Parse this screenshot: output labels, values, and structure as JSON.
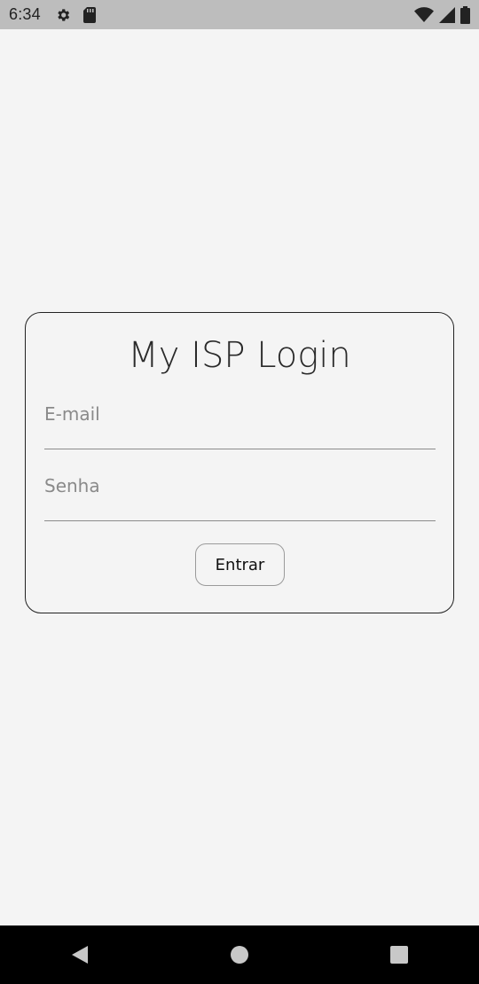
{
  "status_bar": {
    "time": "6:34",
    "left_icons": [
      "gear-icon",
      "sd-card-icon"
    ],
    "right_icons": [
      "wifi-icon",
      "signal-icon",
      "battery-icon"
    ]
  },
  "login": {
    "title": "My ISP Login",
    "email_placeholder": "E-mail",
    "email_value": "",
    "password_placeholder": "Senha",
    "password_value": "",
    "submit_label": "Entrar"
  },
  "nav_bar": {
    "buttons": [
      "back-icon",
      "home-icon",
      "recents-icon"
    ]
  },
  "colors": {
    "background": "#f4f4f4",
    "status_bar": "#bdbdbd",
    "nav_bar": "#000000",
    "card_border": "#222222",
    "field_underline": "#8a8a8a"
  }
}
